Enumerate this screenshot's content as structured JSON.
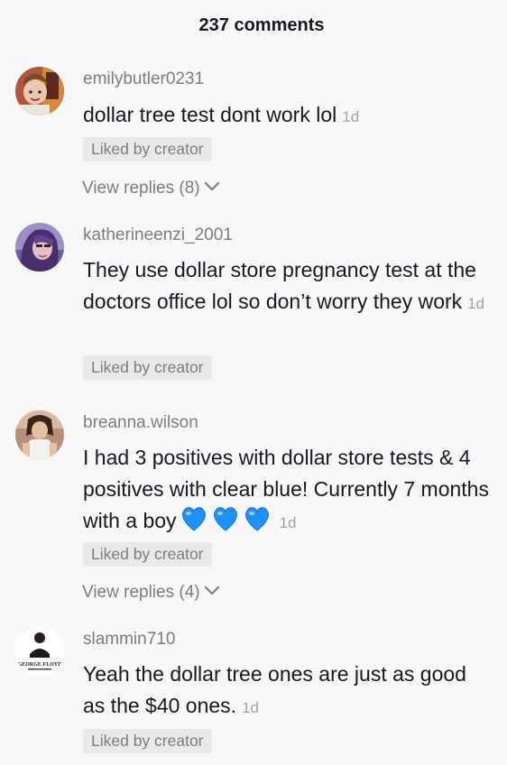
{
  "header": {
    "title": "237 comments"
  },
  "comments": [
    {
      "username": "emilybutler0231",
      "text": "dollar tree test dont work lol",
      "time": "1d",
      "liked_label": "Liked by creator",
      "replies_label": "View replies (8)",
      "avatar_icon": "avatar-photo-icon"
    },
    {
      "username": "katherineenzi_2001",
      "text": "They use dollar store pregnancy test at the doctors office lol so don’t worry they work",
      "time": "1d",
      "liked_label": "Liked by creator",
      "avatar_icon": "avatar-photo-icon"
    },
    {
      "username": "breanna.wilson",
      "text": "I had 3 positives with dollar store tests & 4 positives with clear blue! Currently 7 months with a boy",
      "emoji": "💙💙💙",
      "time": "1d",
      "liked_label": "Liked by creator",
      "replies_label": "View replies (4)",
      "avatar_icon": "avatar-photo-icon"
    },
    {
      "username": "slammin710",
      "text": "Yeah the dollar tree ones are just as good as the $40 ones.",
      "time": "1d",
      "liked_label": "Liked by creator",
      "avatar_icon": "avatar-logo-icon",
      "avatar_text": "GEORGE FLOYD"
    }
  ],
  "colors": {
    "background": "#f8f8f8",
    "primary_text": "#161823",
    "secondary_text": "#7a7c82",
    "time_text": "#a1a2a7",
    "badge_bg": "#e9e9ea",
    "heart_blue": "#1e90ff"
  }
}
